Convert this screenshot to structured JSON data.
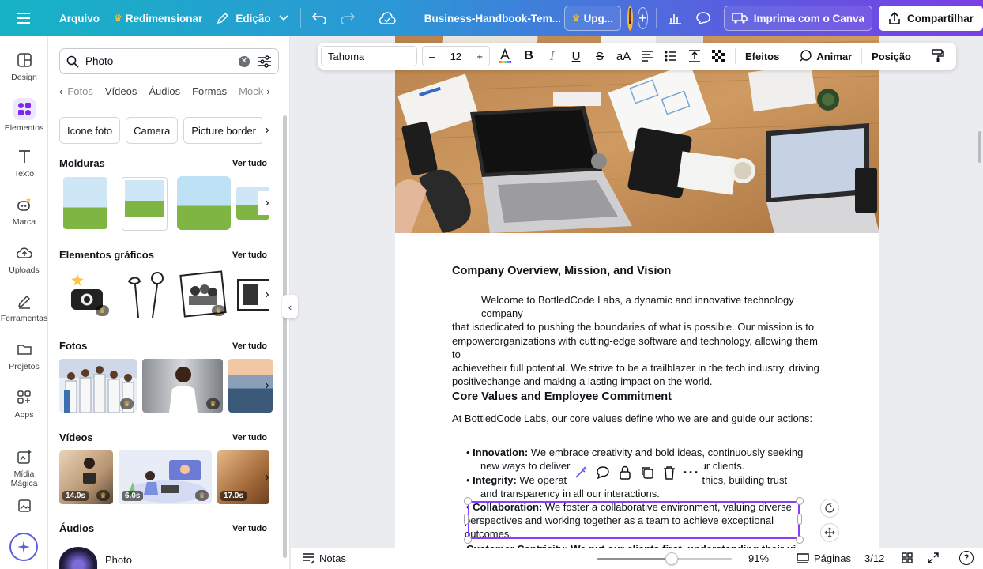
{
  "topbar": {
    "menu_icon": "hamburger-icon",
    "file": "Arquivo",
    "resize": "Redimensionar",
    "edit": "Edição",
    "doc_title": "Business-Handbook-Tem...",
    "upgrade": "Upg...",
    "print": "Imprima com o Canva",
    "share": "Compartilhar"
  },
  "rail": [
    {
      "label": "Design",
      "icon": "layout-icon"
    },
    {
      "label": "Elementos",
      "icon": "shapes-icon"
    },
    {
      "label": "Texto",
      "icon": "text-icon"
    },
    {
      "label": "Marca",
      "icon": "brand-icon"
    },
    {
      "label": "Uploads",
      "icon": "cloud-upload-icon"
    },
    {
      "label": "Ferramentas",
      "icon": "pen-tool-icon"
    },
    {
      "label": "Projetos",
      "icon": "folder-icon"
    },
    {
      "label": "Apps",
      "icon": "apps-icon"
    },
    {
      "label": "Mídia Mágica",
      "icon": "magic-media-icon"
    },
    {
      "label": "",
      "icon": "image-icon"
    }
  ],
  "panel": {
    "search_value": "Photo",
    "categories": [
      "Fotos",
      "Vídeos",
      "Áudios",
      "Formas",
      "Mock"
    ],
    "chips": [
      "Icone foto",
      "Camera",
      "Picture border"
    ],
    "sections": {
      "frames": "Molduras",
      "graphics": "Elementos gráficos",
      "photos": "Fotos",
      "videos": "Vídeos",
      "audios": "Áudios"
    },
    "see_all": "Ver tudo",
    "video_durations": [
      "14.0s",
      "6.0s",
      "17.0s"
    ],
    "audio_title": "Photo"
  },
  "toolbar": {
    "font": "Tahoma",
    "minus": "–",
    "size": "12",
    "plus": "+",
    "case": "aA",
    "effects": "Efeitos",
    "animate": "Animar",
    "position": "Posição"
  },
  "doc": {
    "h1": "Company Overview, Mission, and Vision",
    "p1": [
      "Welcome to BottledCode Labs, a dynamic and innovative technology company",
      "that isdedicated to pushing the boundaries of what is possible. Our mission is to",
      "empowerorganizations with cutting-edge software and technology, allowing them to",
      "achievetheir full potential. We strive to be a trailblazer in the tech industry, driving",
      "positivechange and making a lasting impact on the world."
    ],
    "h2": "Core Values and Employee Commitment",
    "p2": "At BottledCode Labs, our core values define who we are and guide our actions:",
    "b1_title": "Innovation:",
    "b1_l1": "We embrace creativity and bold ideas, continuously seeking",
    "b1_l2a": "new ways to deliver",
    "b1_l2b": "our clients.",
    "b2_title": "Integrity:",
    "b2_l1a": "We operat",
    "b2_l1b": "nd ethics, building trust",
    "b2_l2": "and transparency in all our interactions.",
    "b3_title": "Collaboration:",
    "b3_l1": "We foster a collaborative environment, valuing diverse",
    "b3_l2": "perspectives and working together as a team to achieve exceptional",
    "b3_l3": "outcomes.",
    "b4_partial": "Customer Centricity: We put our clients first, understanding their ui"
  },
  "bottom": {
    "notes": "Notas",
    "zoom": "91%",
    "zoom_level": 0.55,
    "pages": "Páginas",
    "page_count": "3/12"
  },
  "colors": {
    "accent": "#8b3dff",
    "crown": "#ffc53d",
    "topbar_start": "#16b3c5",
    "topbar_end": "#7b3fe4"
  }
}
